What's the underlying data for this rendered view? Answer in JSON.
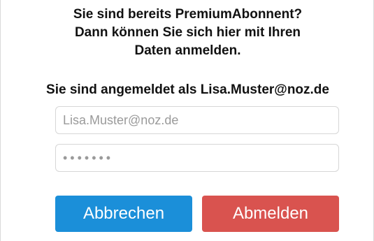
{
  "intro": {
    "line1": "Sie sind bereits PremiumAbonnent?",
    "line2": "Dann können Sie sich hier mit Ihren",
    "line3": "Daten anmelden."
  },
  "status": "Sie sind angemeldet als Lisa.Muster@noz.de",
  "form": {
    "email_placeholder": "Lisa.Muster@noz.de",
    "password_value": "•••••••"
  },
  "buttons": {
    "cancel_label": "Abbrechen",
    "logout_label": "Abmelden"
  },
  "colors": {
    "cancel": "#1b8fd9",
    "logout": "#d9534f"
  }
}
